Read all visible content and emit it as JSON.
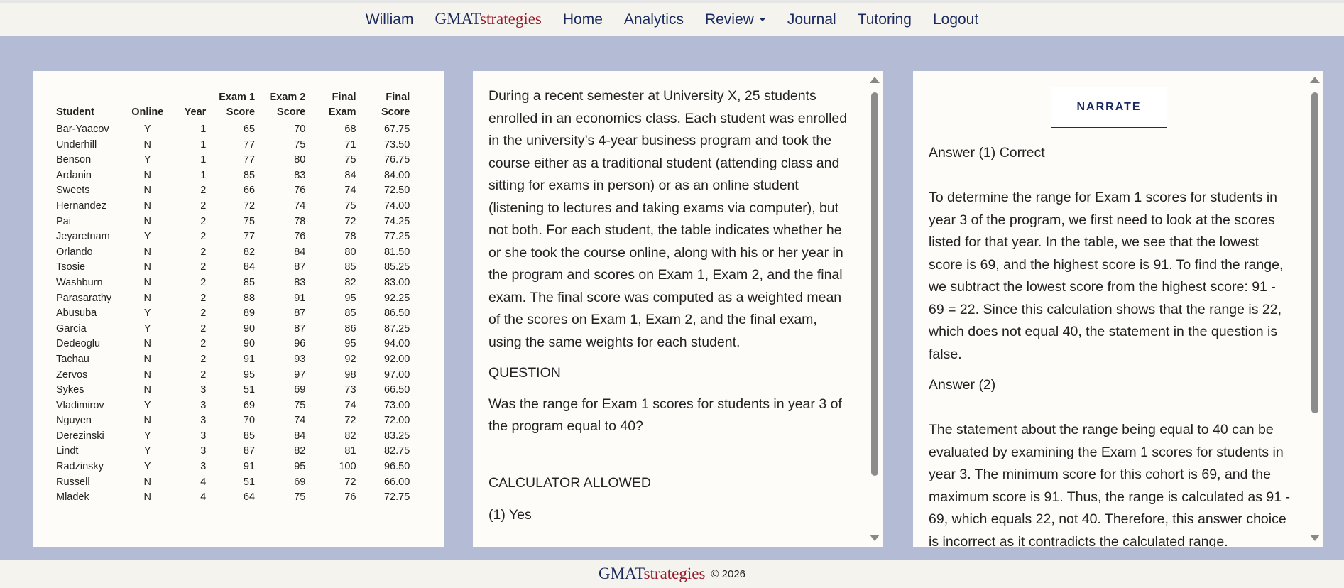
{
  "nav": {
    "user": "William",
    "brand_part1": "GMAT",
    "brand_part2": "strategies",
    "home": "Home",
    "analytics": "Analytics",
    "review": "Review",
    "journal": "Journal",
    "tutoring": "Tutoring",
    "logout": "Logout"
  },
  "table": {
    "headers": {
      "student": "Student",
      "online": "Online",
      "year": "Year",
      "exam1_line1": "Exam 1",
      "exam1_line2": "Score",
      "exam2_line1": "Exam 2",
      "exam2_line2": "Score",
      "final_exam_line1": "Final",
      "final_exam_line2": "Exam",
      "final_score_line1": "Final",
      "final_score_line2": "Score"
    },
    "rows": [
      [
        "Bar-Yaacov",
        "Y",
        "1",
        "65",
        "70",
        "68",
        "67.75"
      ],
      [
        "Underhill",
        "N",
        "1",
        "77",
        "75",
        "71",
        "73.50"
      ],
      [
        "Benson",
        "Y",
        "1",
        "77",
        "80",
        "75",
        "76.75"
      ],
      [
        "Ardanin",
        "N",
        "1",
        "85",
        "83",
        "84",
        "84.00"
      ],
      [
        "Sweets",
        "N",
        "2",
        "66",
        "76",
        "74",
        "72.50"
      ],
      [
        "Hernandez",
        "N",
        "2",
        "72",
        "74",
        "75",
        "74.00"
      ],
      [
        "Pai",
        "N",
        "2",
        "75",
        "78",
        "72",
        "74.25"
      ],
      [
        "Jeyaretnam",
        "Y",
        "2",
        "77",
        "76",
        "78",
        "77.25"
      ],
      [
        "Orlando",
        "N",
        "2",
        "82",
        "84",
        "80",
        "81.50"
      ],
      [
        "Tsosie",
        "N",
        "2",
        "84",
        "87",
        "85",
        "85.25"
      ],
      [
        "Washburn",
        "N",
        "2",
        "85",
        "83",
        "82",
        "83.00"
      ],
      [
        "Parasarathy",
        "N",
        "2",
        "88",
        "91",
        "95",
        "92.25"
      ],
      [
        "Abusuba",
        "Y",
        "2",
        "89",
        "87",
        "85",
        "86.50"
      ],
      [
        "Garcia",
        "Y",
        "2",
        "90",
        "87",
        "86",
        "87.25"
      ],
      [
        "Dedeoglu",
        "N",
        "2",
        "90",
        "96",
        "95",
        "94.00"
      ],
      [
        "Tachau",
        "N",
        "2",
        "91",
        "93",
        "92",
        "92.00"
      ],
      [
        "Zervos",
        "N",
        "2",
        "95",
        "97",
        "98",
        "97.00"
      ],
      [
        "Sykes",
        "N",
        "3",
        "51",
        "69",
        "73",
        "66.50"
      ],
      [
        "Vladimirov",
        "Y",
        "3",
        "69",
        "75",
        "74",
        "73.00"
      ],
      [
        "Nguyen",
        "N",
        "3",
        "70",
        "74",
        "72",
        "72.00"
      ],
      [
        "Derezinski",
        "Y",
        "3",
        "85",
        "84",
        "82",
        "83.25"
      ],
      [
        "Lindt",
        "Y",
        "3",
        "87",
        "82",
        "81",
        "82.75"
      ],
      [
        "Radzinsky",
        "Y",
        "3",
        "91",
        "95",
        "100",
        "96.50"
      ],
      [
        "Russell",
        "N",
        "4",
        "51",
        "69",
        "72",
        "66.00"
      ],
      [
        "Mladek",
        "N",
        "4",
        "64",
        "75",
        "76",
        "72.75"
      ]
    ]
  },
  "question": {
    "passage": "During a recent semester at University X, 25 students enrolled in an economics class. Each student was enrolled in the university’s 4-year business program and took the course either as a traditional student (attending class and sitting for exams in person) or as an online student (listening to lectures and taking exams via computer), but not both. For each student, the table indicates whether he or she took the course online, along with his or her year in the program and scores on Exam 1, Exam 2, and the final exam. The final score was computed as a weighted mean of the scores on Exam 1, Exam 2, and the final exam, using the same weights for each student.",
    "heading": "QUESTION",
    "text": "Was the range for Exam 1 scores for students in year 3 of the program equal to 40?",
    "calculator": "CALCULATOR ALLOWED",
    "choice1": "(1) Yes"
  },
  "answer": {
    "narrate_label": "NARRATE",
    "answer1_heading": "Answer (1) Correct",
    "answer1_text": "To determine the range for Exam 1 scores for students in year 3 of the program, we first need to look at the scores listed for that year. In the table, we see that the lowest score is 69, and the highest score is 91. To find the range, we subtract the lowest score from the highest score: 91 - 69 = 22. Since this calculation shows that the range is 22, which does not equal 40, the statement in the question is false.",
    "answer2_heading": "Answer (2)",
    "answer2_text": "The statement about the range being equal to 40 can be evaluated by examining the Exam 1 scores for students in year 3. The minimum score for this cohort is 69, and the maximum score is 91. Thus, the range is calculated as 91 - 69, which equals 22, not 40. Therefore, this answer choice is incorrect as it contradicts the calculated range."
  },
  "footer": {
    "brand_part1": "GMAT",
    "brand_part2": "strategies",
    "copyright": "© 2026"
  },
  "colors": {
    "background": "#b3bcd4",
    "navy": "#1a2a5e",
    "brand_red": "#9b1b2e",
    "panel": "#fdfcf9"
  }
}
